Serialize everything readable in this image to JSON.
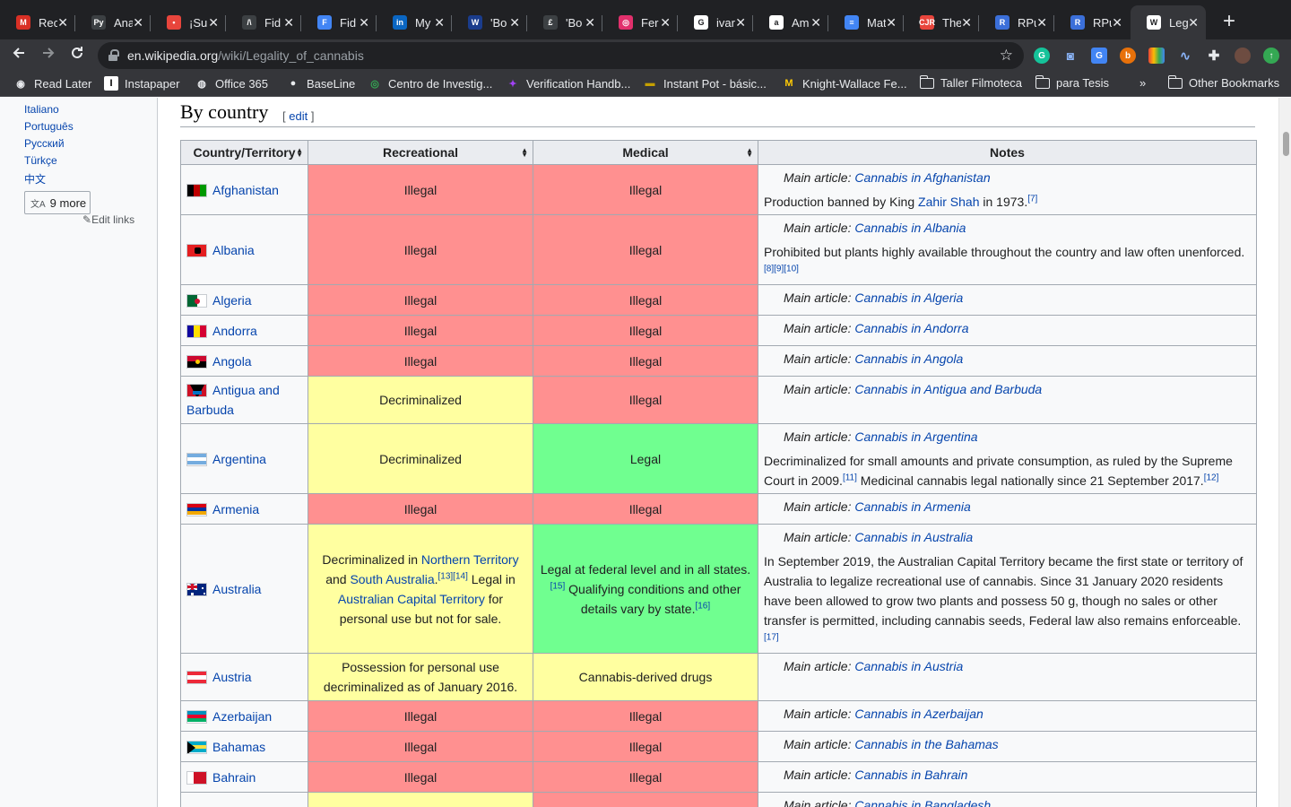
{
  "browser": {
    "tabs": [
      {
        "title": "Rec",
        "favicon": "gmail-icon",
        "color": "#d93025",
        "glyph": "M"
      },
      {
        "title": "Ana",
        "favicon": "py-icon",
        "color": "#3c4043",
        "glyph": "Py"
      },
      {
        "title": "¡Su",
        "favicon": "sun-icon",
        "color": "#e8453c",
        "glyph": "•"
      },
      {
        "title": "Fid",
        "favicon": "fid-icon",
        "color": "#3c4043",
        "glyph": "/\\"
      },
      {
        "title": "Fid",
        "favicon": "fid-blue-icon",
        "color": "#4285f4",
        "glyph": "F"
      },
      {
        "title": "My",
        "favicon": "linkedin-icon",
        "color": "#0a66c2",
        "glyph": "in"
      },
      {
        "title": "'Bo",
        "favicon": "w-icon",
        "color": "#1a3c8c",
        "glyph": "W"
      },
      {
        "title": "'Bo",
        "favicon": "book-icon",
        "color": "#3c4043",
        "glyph": "£"
      },
      {
        "title": "Fer",
        "favicon": "instagram-icon",
        "color": "#e1306c",
        "glyph": "◎"
      },
      {
        "title": "ivar",
        "favicon": "google-icon",
        "color": "#ffffff",
        "glyph": "G"
      },
      {
        "title": "Am",
        "favicon": "amazon-icon",
        "color": "#ffffff",
        "glyph": "a"
      },
      {
        "title": "Mat",
        "favicon": "docs-icon",
        "color": "#4285f4",
        "glyph": "≡"
      },
      {
        "title": "The",
        "favicon": "cjr-icon",
        "color": "#e8453c",
        "glyph": "CJR"
      },
      {
        "title": "RPu",
        "favicon": "r-icon",
        "color": "#3b6fd9",
        "glyph": "R"
      },
      {
        "title": "RPu",
        "favicon": "r-icon",
        "color": "#3b6fd9",
        "glyph": "R"
      },
      {
        "title": "Leg",
        "favicon": "wikipedia-icon",
        "color": "#ffffff",
        "glyph": "W",
        "active": true
      }
    ],
    "url_host": "en.wikipedia.org",
    "url_path": "/wiki/Legality_of_cannabis",
    "bookmarks": [
      {
        "label": "Read Later",
        "icon": "read-later-icon",
        "color": "#e8eaed"
      },
      {
        "label": "Instapaper",
        "icon": "instapaper-icon",
        "color": "#ffffff"
      },
      {
        "label": "Office 365",
        "icon": "globe-icon",
        "color": "#e8eaed"
      },
      {
        "label": "BaseLine",
        "icon": "apple-icon",
        "color": "#e8eaed"
      },
      {
        "label": "Centro de Investig...",
        "icon": "centro-icon",
        "color": "#34a853"
      },
      {
        "label": "Verification Handb...",
        "icon": "verification-icon",
        "color": "#a142f4"
      },
      {
        "label": "Instant Pot - básic...",
        "icon": "instantpot-icon",
        "color": "#c5a000"
      },
      {
        "label": "Knight-Wallace Fe...",
        "icon": "michigan-icon",
        "color": "#ffcb05"
      },
      {
        "label": "Taller Filmoteca",
        "icon": "folder-icon",
        "color": ""
      },
      {
        "label": "para Tesis",
        "icon": "folder-icon",
        "color": ""
      }
    ],
    "bookmarks_overflow": "»",
    "other_bookmarks": "Other Bookmarks"
  },
  "sidebar": {
    "languages": [
      "Italiano",
      "Português",
      "Русский",
      "Türkçe",
      "中文"
    ],
    "more_label": "9 more",
    "edit_links": "Edit links"
  },
  "section": {
    "title": "By country",
    "edit_open": "[",
    "edit": "edit",
    "edit_close": "]"
  },
  "table": {
    "headers": [
      "Country/Territory",
      "Recreational",
      "Medical",
      "Notes"
    ],
    "main_article_prefix": "Main article:",
    "rows": [
      {
        "country": "Afghanistan",
        "flag": "afghanistan",
        "rec": "Illegal",
        "rec_status": "ill",
        "med": "Illegal",
        "med_status": "ill",
        "main": "Cannabis in Afghanistan",
        "note_a": "Production banned by King ",
        "note_link": "Zahir Shah",
        "note_b": " in 1973.",
        "refs": "[7]"
      },
      {
        "country": "Albania",
        "flag": "albania",
        "rec": "Illegal",
        "rec_status": "ill",
        "med": "Illegal",
        "med_status": "ill",
        "main": "Cannabis in Albania",
        "note_a": "Prohibited but plants highly available throughout the country and law often unenforced.",
        "refs": "[8][9][10]"
      },
      {
        "country": "Algeria",
        "flag": "algeria",
        "rec": "Illegal",
        "rec_status": "ill",
        "med": "Illegal",
        "med_status": "ill",
        "main": "Cannabis in Algeria"
      },
      {
        "country": "Andorra",
        "flag": "andorra",
        "rec": "Illegal",
        "rec_status": "ill",
        "med": "Illegal",
        "med_status": "ill",
        "main": "Cannabis in Andorra"
      },
      {
        "country": "Angola",
        "flag": "angola",
        "rec": "Illegal",
        "rec_status": "ill",
        "med": "Illegal",
        "med_status": "ill",
        "main": "Cannabis in Angola"
      },
      {
        "country": "Antigua and Barbuda",
        "flag": "antigua",
        "rec": "Decriminalized",
        "rec_status": "dec",
        "med": "Illegal",
        "med_status": "ill",
        "main": "Cannabis in Antigua and Barbuda"
      },
      {
        "country": "Argentina",
        "flag": "argentina",
        "rec": "Decriminalized",
        "rec_status": "dec",
        "med": "Legal",
        "med_status": "leg",
        "main": "Cannabis in Argentina",
        "note_a": "Decriminalized for small amounts and private consumption, as ruled by the Supreme Court in 2009.",
        "refs": "[11]",
        "note_b": " Medicinal cannabis legal nationally since 21 September 2017.",
        "refs2": "[12]"
      },
      {
        "country": "Armenia",
        "flag": "armenia",
        "rec": "Illegal",
        "rec_status": "ill",
        "med": "Illegal",
        "med_status": "ill",
        "main": "Cannabis in Armenia"
      },
      {
        "country": "Australia",
        "flag": "australia",
        "rec_status": "dec",
        "med_status": "leg",
        "main": "Cannabis in Australia",
        "rec_parts": {
          "t1": "Decriminalized in ",
          "l1": "Northern Territory",
          "t2": " and ",
          "l2": "South Australia",
          "t3": ".",
          "r1": "[13][14]",
          "t4": " Legal in ",
          "l3": "Australian Capital Territory",
          "t5": " for personal use but not for sale."
        },
        "med_parts": {
          "t1": "Legal at federal level and in all states.",
          "r1": "[15]",
          "t2": " Qualifying conditions and other details vary by state.",
          "r2": "[16]"
        },
        "note_a": "In September 2019, the Australian Capital Territory became the first state or territory of Australia to legalize recreational use of cannabis. Since 31 January 2020 residents have been allowed to grow two plants and possess 50 g, though no sales or other transfer is permitted, including cannabis seeds, Federal law also remains enforceable.",
        "refs": "[17]"
      },
      {
        "country": "Austria",
        "flag": "austria",
        "rec": "Possession for personal use decriminalized as of January 2016.",
        "rec_status": "dec",
        "med": "Cannabis-derived drugs",
        "med_status": "dec",
        "main": "Cannabis in Austria"
      },
      {
        "country": "Azerbaijan",
        "flag": "azerbaijan",
        "rec": "Illegal",
        "rec_status": "ill",
        "med": "Illegal",
        "med_status": "ill",
        "main": "Cannabis in Azerbaijan"
      },
      {
        "country": "Bahamas",
        "flag": "bahamas",
        "rec": "Illegal",
        "rec_status": "ill",
        "med": "Illegal",
        "med_status": "ill",
        "main": "Cannabis in the Bahamas"
      },
      {
        "country": "Bahrain",
        "flag": "bahrain",
        "rec": "Illegal",
        "rec_status": "ill",
        "med": "Illegal",
        "med_status": "ill",
        "main": "Cannabis in Bahrain"
      },
      {
        "country": "",
        "flag": "",
        "rec": "",
        "rec_status": "dec",
        "med": "",
        "med_status": "ill",
        "main": "Cannabis in Bangladesh"
      }
    ]
  }
}
